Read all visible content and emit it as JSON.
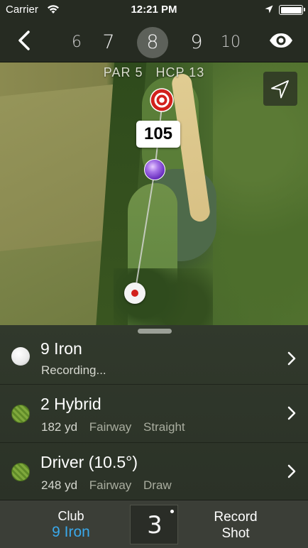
{
  "status_bar": {
    "carrier": "Carrier",
    "time": "12:21 PM",
    "icons": [
      "wifi-icon",
      "location-arrow-icon",
      "battery-icon"
    ]
  },
  "nav": {
    "back_icon": "chevron-left-icon",
    "holes": [
      "6",
      "7",
      "8",
      "9",
      "10"
    ],
    "current_hole": "8",
    "view_icon": "eye-icon"
  },
  "map": {
    "par": "PAR 5",
    "hcp": "HCP 13",
    "distance": "105",
    "locate_icon": "location-arrow-outline-icon",
    "markers": [
      "target-pin-icon",
      "aim-marker",
      "ball-marker"
    ]
  },
  "shots": [
    {
      "club": "9 Iron",
      "detail": "Recording...",
      "ball": "white-ball-icon"
    },
    {
      "club": "2 Hybrid",
      "distance": "182 yd",
      "lie": "Fairway",
      "shape": "Straight",
      "ball": "green-ball-icon"
    },
    {
      "club": "Driver (10.5°)",
      "distance": "248 yd",
      "lie": "Fairway",
      "shape": "Draw",
      "ball": "green-ball-icon"
    }
  ],
  "bottom_bar": {
    "club_label": "Club",
    "club_value": "9 Iron",
    "stroke_count": "3",
    "record_line1": "Record",
    "record_line2": "Shot"
  },
  "colors": {
    "accent_blue": "#3aa8ea",
    "target_red": "#d2201b",
    "aim_purple": "#6a2fc0",
    "panel_dark": "#2b3227"
  }
}
